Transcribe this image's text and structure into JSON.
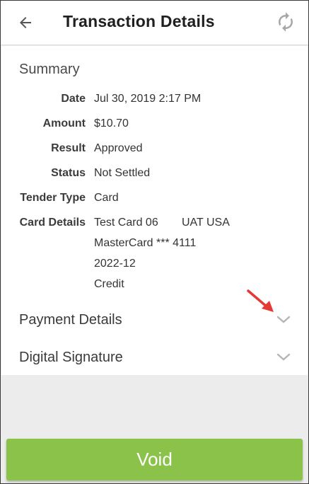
{
  "header": {
    "title": "Transaction Details",
    "back_icon": "back-arrow-icon",
    "refresh_icon": "refresh-icon"
  },
  "summary": {
    "title": "Summary",
    "fields": [
      {
        "label": "Date",
        "value": "Jul 30, 2019 2:17 PM"
      },
      {
        "label": "Amount",
        "value": "$10.70"
      },
      {
        "label": "Result",
        "value": "Approved"
      },
      {
        "label": "Status",
        "value": "Not Settled"
      },
      {
        "label": "Tender Type",
        "value": "Card"
      }
    ],
    "card_details": {
      "label": "Card Details",
      "card_name": "Test Card 06",
      "environment": "UAT USA",
      "card_number": "MasterCard *** 4111",
      "expiry": "2022-12",
      "type": "Credit"
    }
  },
  "sections": [
    {
      "title": "Payment Details",
      "icon": "chevron-down-icon"
    },
    {
      "title": "Digital Signature",
      "icon": "chevron-down-icon"
    }
  ],
  "annotation": {
    "icon": "red-pointer-arrow-icon",
    "color": "#e53935"
  },
  "actions": {
    "void_label": "Void",
    "void_color": "#8bc34a"
  }
}
